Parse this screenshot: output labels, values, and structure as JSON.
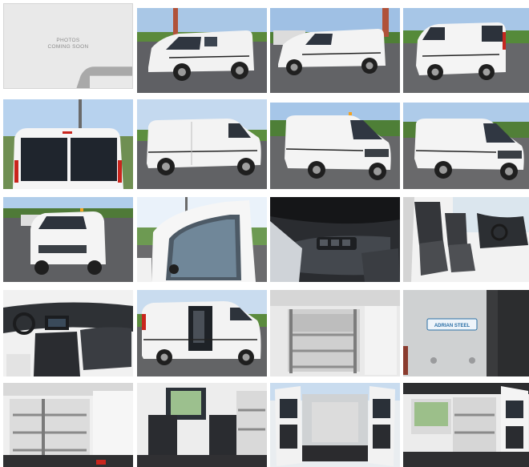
{
  "gallery": {
    "placeholder": {
      "line1": "PHOTOS",
      "line2": "COMING SOON",
      "icon": "car-icon"
    },
    "brand_label": "ADRIAN STEEL",
    "photos": [
      {
        "name": "van-front-side"
      },
      {
        "name": "van-front-side-lot"
      },
      {
        "name": "van-rear-side"
      },
      {
        "name": "van-rear-doors"
      },
      {
        "name": "van-left-side"
      },
      {
        "name": "van-front-three-quarter"
      },
      {
        "name": "van-front-angle"
      },
      {
        "name": "van-front-parking-lot"
      },
      {
        "name": "open-front-door"
      },
      {
        "name": "door-panel-switches"
      },
      {
        "name": "front-seats"
      },
      {
        "name": "dashboard"
      },
      {
        "name": "sliding-door-open"
      },
      {
        "name": "cargo-shelving"
      },
      {
        "name": "adrian-steel-badge"
      },
      {
        "name": "cargo-shelving-interior"
      },
      {
        "name": "cargo-rear-view"
      },
      {
        "name": "rear-doors-open"
      },
      {
        "name": "cargo-side-interior"
      }
    ]
  }
}
